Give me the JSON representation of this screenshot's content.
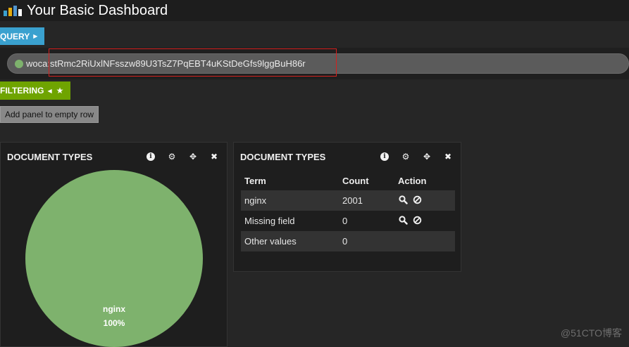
{
  "app": {
    "title": "Your Basic Dashboard",
    "logo_icon": "kibana-logo-icon"
  },
  "query": {
    "tab_label": "QUERY",
    "tab_color": "#3aa1cf",
    "value": "woca:stRmc2RiUxlNFsszw89U3TsZ7PqEBT4uKStDeGfs9lggBuH86r",
    "status_color": "#7eb26d"
  },
  "filtering": {
    "tab_label": "FILTERING",
    "tab_color": "#6fa400"
  },
  "add_panel": {
    "label": "Add panel to empty row"
  },
  "panels": [
    {
      "title": "DOCUMENT TYPES",
      "icons": [
        "info-icon",
        "gear-icon",
        "move-icon",
        "close-icon"
      ]
    },
    {
      "title": "DOCUMENT TYPES",
      "icons": [
        "info-icon",
        "gear-icon",
        "move-icon",
        "close-icon"
      ],
      "table": {
        "headers": [
          "Term",
          "Count",
          "Action"
        ],
        "rows": [
          {
            "term": "nginx",
            "count": "2001",
            "has_actions": true
          },
          {
            "term": "Missing field",
            "count": "0",
            "has_actions": true
          },
          {
            "term": "Other values",
            "count": "0",
            "has_actions": false
          }
        ]
      }
    }
  ],
  "chart_data": {
    "type": "pie",
    "categories": [
      "nginx"
    ],
    "values": [
      100
    ],
    "labels": [
      "nginx",
      "100%"
    ],
    "colors": [
      "#7eb26d"
    ],
    "title": ""
  },
  "watermark": "@51CTO博客"
}
